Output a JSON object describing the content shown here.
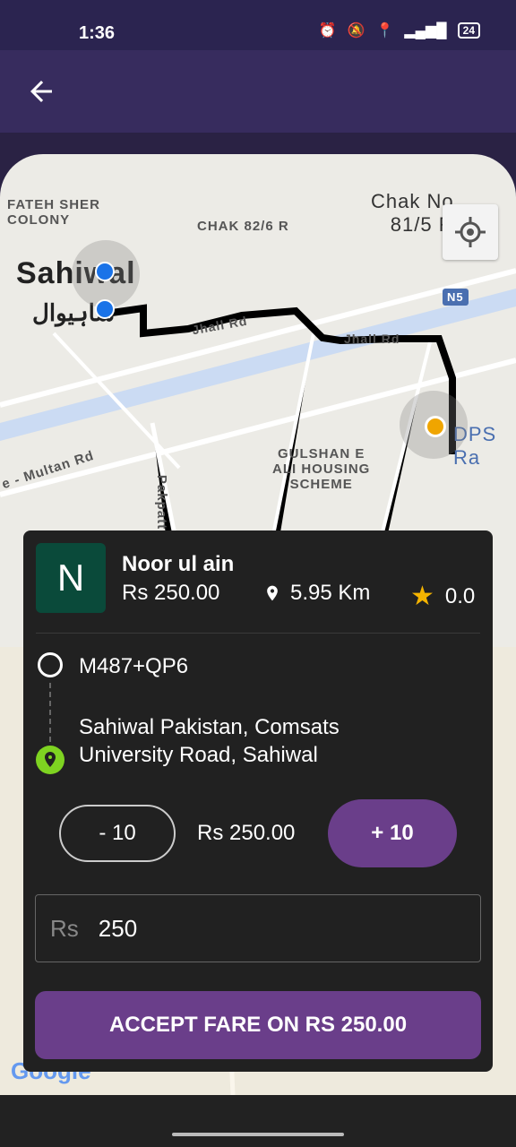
{
  "status_bar": {
    "time": "1:36",
    "battery": "24"
  },
  "map": {
    "labels": {
      "fateh_sher": "FATEH SHER\nCOLONY",
      "chak_82": "CHAK 82/6 R",
      "chak_no": "Chak No\n81/5 R",
      "sahiwal": "Sahiwal",
      "sahiwal_urdu": "ساہیوال",
      "jhall_rd_1": "Jhall Rd",
      "jhall_rd_2": "Jhall Rd",
      "n5": "N5",
      "dps": "DPS Ra",
      "gulshan": "GULSHAN E\nALI HOUSING\nSCHEME",
      "multan_rd": "e - Multan Rd",
      "pakpattan": "Pakpatt",
      "google": "Google"
    }
  },
  "rider": {
    "initial": "N",
    "name": "Noor ul ain",
    "price": "Rs 250.00",
    "distance": "5.95 Km",
    "rating": "0.0"
  },
  "route": {
    "pickup": "M487+QP6",
    "dropoff": "Sahiwal Pakistan, Comsats\nUniversity Road, Sahiwal"
  },
  "fare_controls": {
    "minus_label": "- 10",
    "current_fare": "Rs 250.00",
    "plus_label": "+ 10",
    "input_prefix": "Rs",
    "input_value": "250"
  },
  "accept_button": "ACCEPT FARE ON RS 250.00"
}
